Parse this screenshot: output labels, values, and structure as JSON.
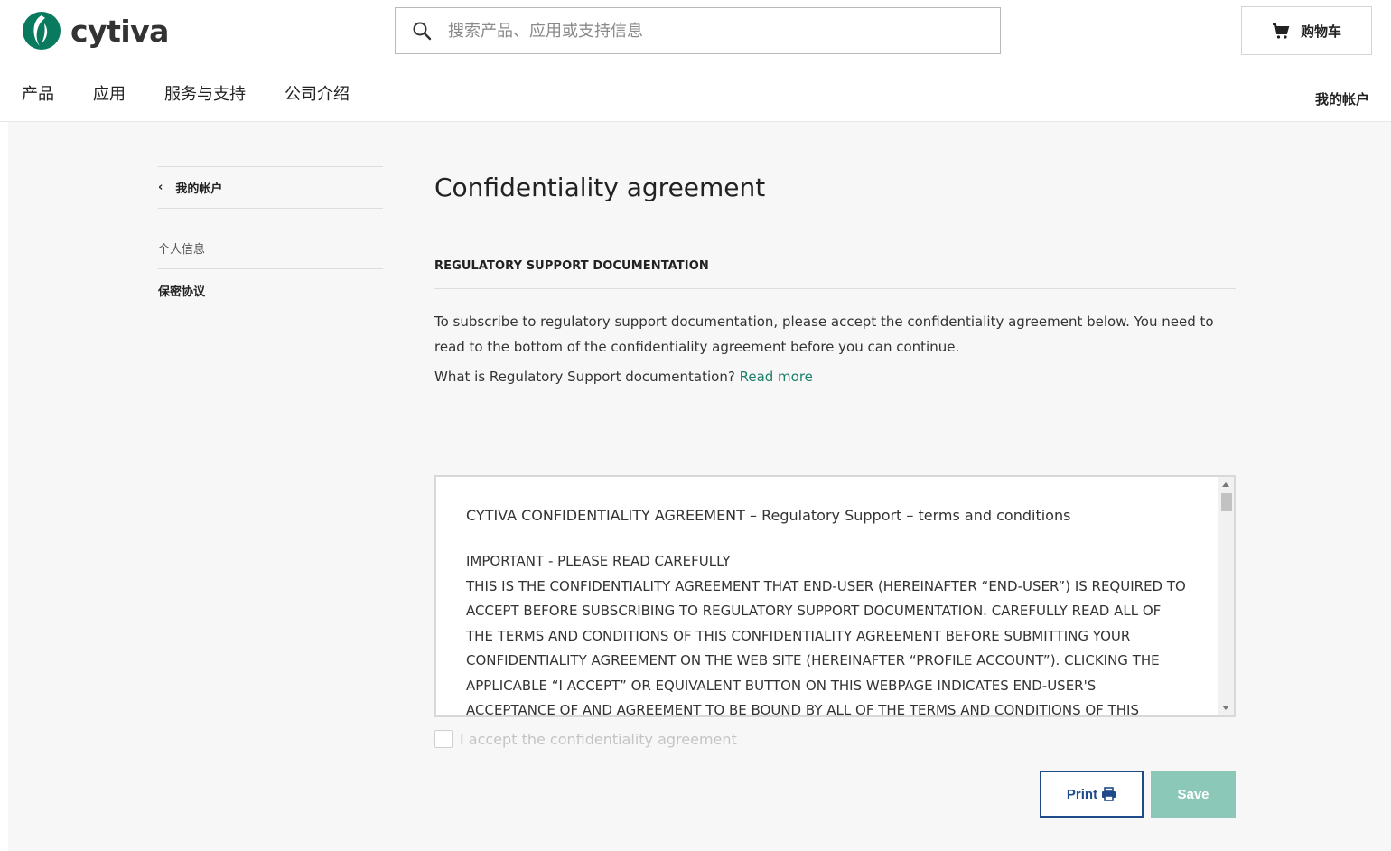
{
  "header": {
    "brand": "cytiva",
    "search_placeholder": "搜索产品、应用或支持信息",
    "cart_label": "购物车",
    "nav": [
      "产品",
      "应用",
      "服务与支持",
      "公司介绍"
    ],
    "account_label": "我的帐户"
  },
  "sidebar": {
    "back_label": "我的帐户",
    "items": [
      {
        "label": "个人信息",
        "active": false
      },
      {
        "label": "保密协议",
        "active": true
      }
    ]
  },
  "main": {
    "title": "Confidentiality agreement",
    "subheading": "REGULATORY SUPPORT DOCUMENTATION",
    "intro": "To subscribe to regulatory support documentation, please accept the confidentiality agreement below. You need to read to the bottom of the confidentiality agreement before you can continue.",
    "whatis": "What is Regulatory Support documentation?",
    "readmore": "Read more",
    "agreement": {
      "heading": "CYTIVA CONFIDENTIALITY AGREEMENT – Regulatory Support – terms and conditions",
      "lines": [
        "IMPORTANT - PLEASE READ CAREFULLY",
        "THIS IS THE CONFIDENTIALITY AGREEMENT THAT END-USER (HEREINAFTER “END-USER”) IS REQUIRED TO",
        "ACCEPT BEFORE SUBSCRIBING TO REGULATORY SUPPORT DOCUMENTATION.  CAREFULLY READ ALL OF",
        "THE TERMS AND CONDITIONS OF THIS CONFIDENTIALITY AGREEMENT BEFORE SUBMITTING YOUR",
        "CONFIDENTIALITY AGREEMENT ON THE WEB SITE (HEREINAFTER “PROFILE ACCOUNT”). CLICKING THE",
        "APPLICABLE “I ACCEPT” OR EQUIVALENT BUTTON ON THIS WEBPAGE INDICATES END-USER'S",
        "ACCEPTANCE OF AND AGREEMENT TO BE BOUND BY ALL OF THE TERMS AND CONDITIONS OF THIS"
      ]
    },
    "accept_label": "I accept the confidentiality agreement",
    "print_label": "Print",
    "save_label": "Save"
  },
  "colors": {
    "brand_green": "#0a7a5e",
    "link": "#1a7f6a",
    "print_border": "#1f4a8a",
    "save_bg": "#8cc8b8"
  }
}
